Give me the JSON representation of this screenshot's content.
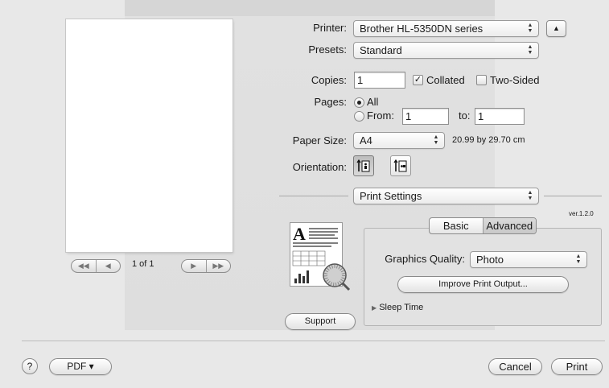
{
  "preview": {
    "page_indicator": "1 of 1"
  },
  "printer": {
    "label": "Printer:",
    "value": "Brother HL-5350DN series"
  },
  "presets": {
    "label": "Presets:",
    "value": "Standard"
  },
  "copies": {
    "label": "Copies:",
    "value": "1",
    "collated_label": "Collated",
    "collated_checked": true,
    "two_sided_label": "Two-Sided",
    "two_sided_checked": false
  },
  "pages": {
    "label": "Pages:",
    "all_label": "All",
    "from_label": "From:",
    "from_value": "1",
    "to_label": "to:",
    "to_value": "1"
  },
  "paper_size": {
    "label": "Paper Size:",
    "value": "A4",
    "dimensions": "20.99 by 29.70 cm"
  },
  "orientation": {
    "label": "Orientation:"
  },
  "pane": {
    "value": "Print Settings",
    "version": "ver.1.2.0"
  },
  "tabs": {
    "basic": "Basic",
    "advanced": "Advanced"
  },
  "graphics_quality": {
    "label": "Graphics Quality:",
    "value": "Photo"
  },
  "improve_button": "Improve Print Output...",
  "sleep_time": "Sleep Time",
  "support_button": "Support",
  "footer": {
    "help": "?",
    "pdf": "PDF ▾",
    "cancel": "Cancel",
    "print": "Print"
  }
}
